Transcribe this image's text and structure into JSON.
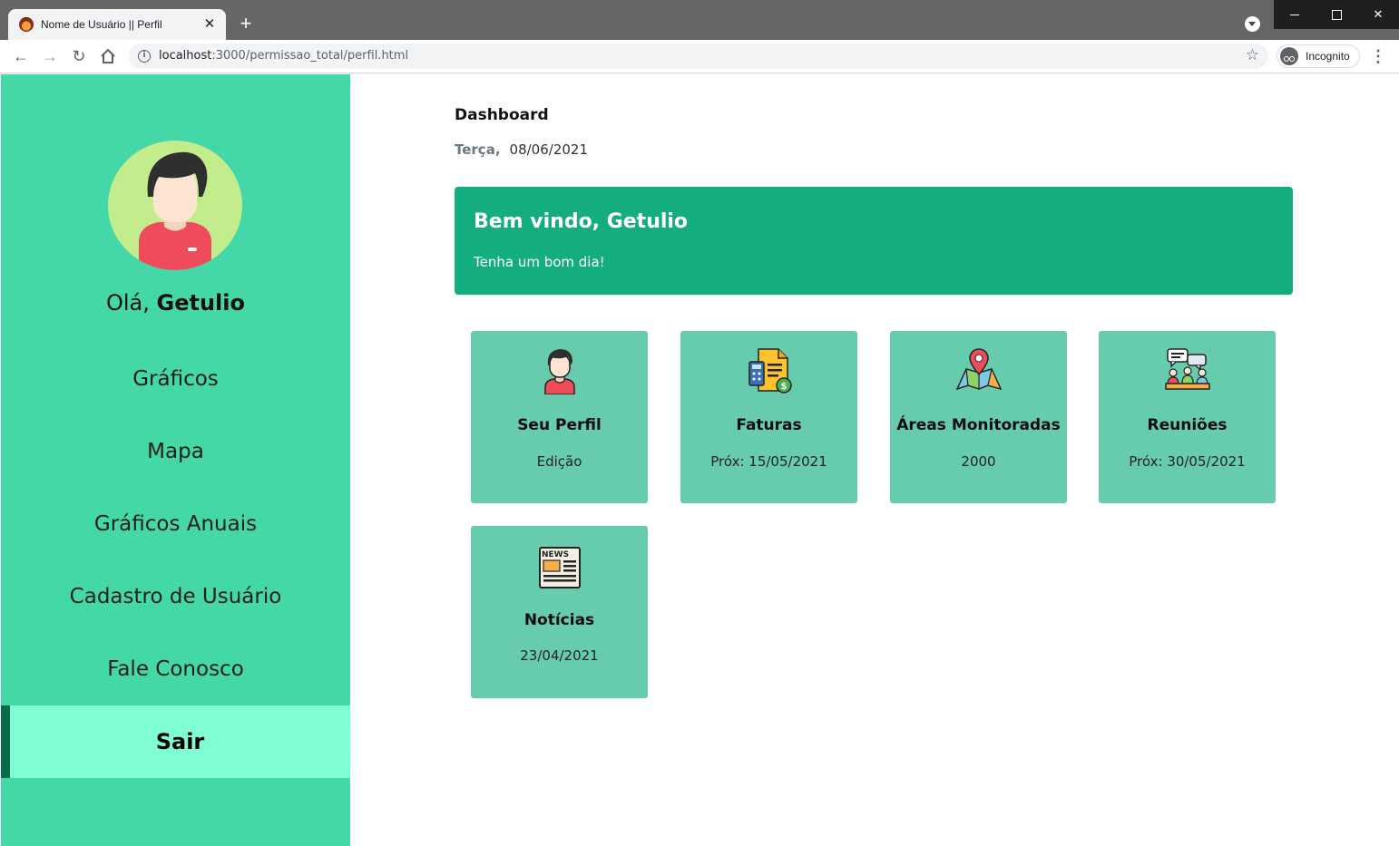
{
  "browser": {
    "tab_title": "Nome de Usuário || Perfil",
    "tab_close": "✕",
    "new_tab": "+",
    "url_host": "localhost",
    "url_path": ":3000/permissao_total/perfil.html",
    "incognito_label": "Incognito",
    "menu": "⋮"
  },
  "sidebar": {
    "greeting_prefix": "Olá, ",
    "user_name": "Getulio",
    "items": [
      {
        "label": "Gráficos"
      },
      {
        "label": "Mapa"
      },
      {
        "label": "Gráficos Anuais"
      },
      {
        "label": "Cadastro de Usuário"
      },
      {
        "label": "Fale Conosco"
      },
      {
        "label": "Sair"
      }
    ]
  },
  "main": {
    "title": "Dashboard",
    "weekday": "Terça,",
    "date": "08/06/2021",
    "welcome_title": "Bem vindo, Getulio",
    "welcome_sub": "Tenha um bom dia!",
    "cards": [
      {
        "title": "Seu Perfil",
        "value": "Edição",
        "icon": "person-icon"
      },
      {
        "title": "Faturas",
        "value": "Próx: 15/05/2021",
        "icon": "invoice-icon"
      },
      {
        "title": "Áreas Monitoradas",
        "value": "2000",
        "icon": "map-pin-icon"
      },
      {
        "title": "Reuniões",
        "value": "Próx: 30/05/2021",
        "icon": "meeting-icon"
      },
      {
        "title": "Notícias",
        "value": "23/04/2021",
        "icon": "newspaper-icon"
      }
    ]
  },
  "colors": {
    "sidebar_bg": "#44d7a8",
    "sidebar_active_bg": "#7ffdd4",
    "welcome_bg": "#13ad7f",
    "card_bg": "#66ccad"
  }
}
